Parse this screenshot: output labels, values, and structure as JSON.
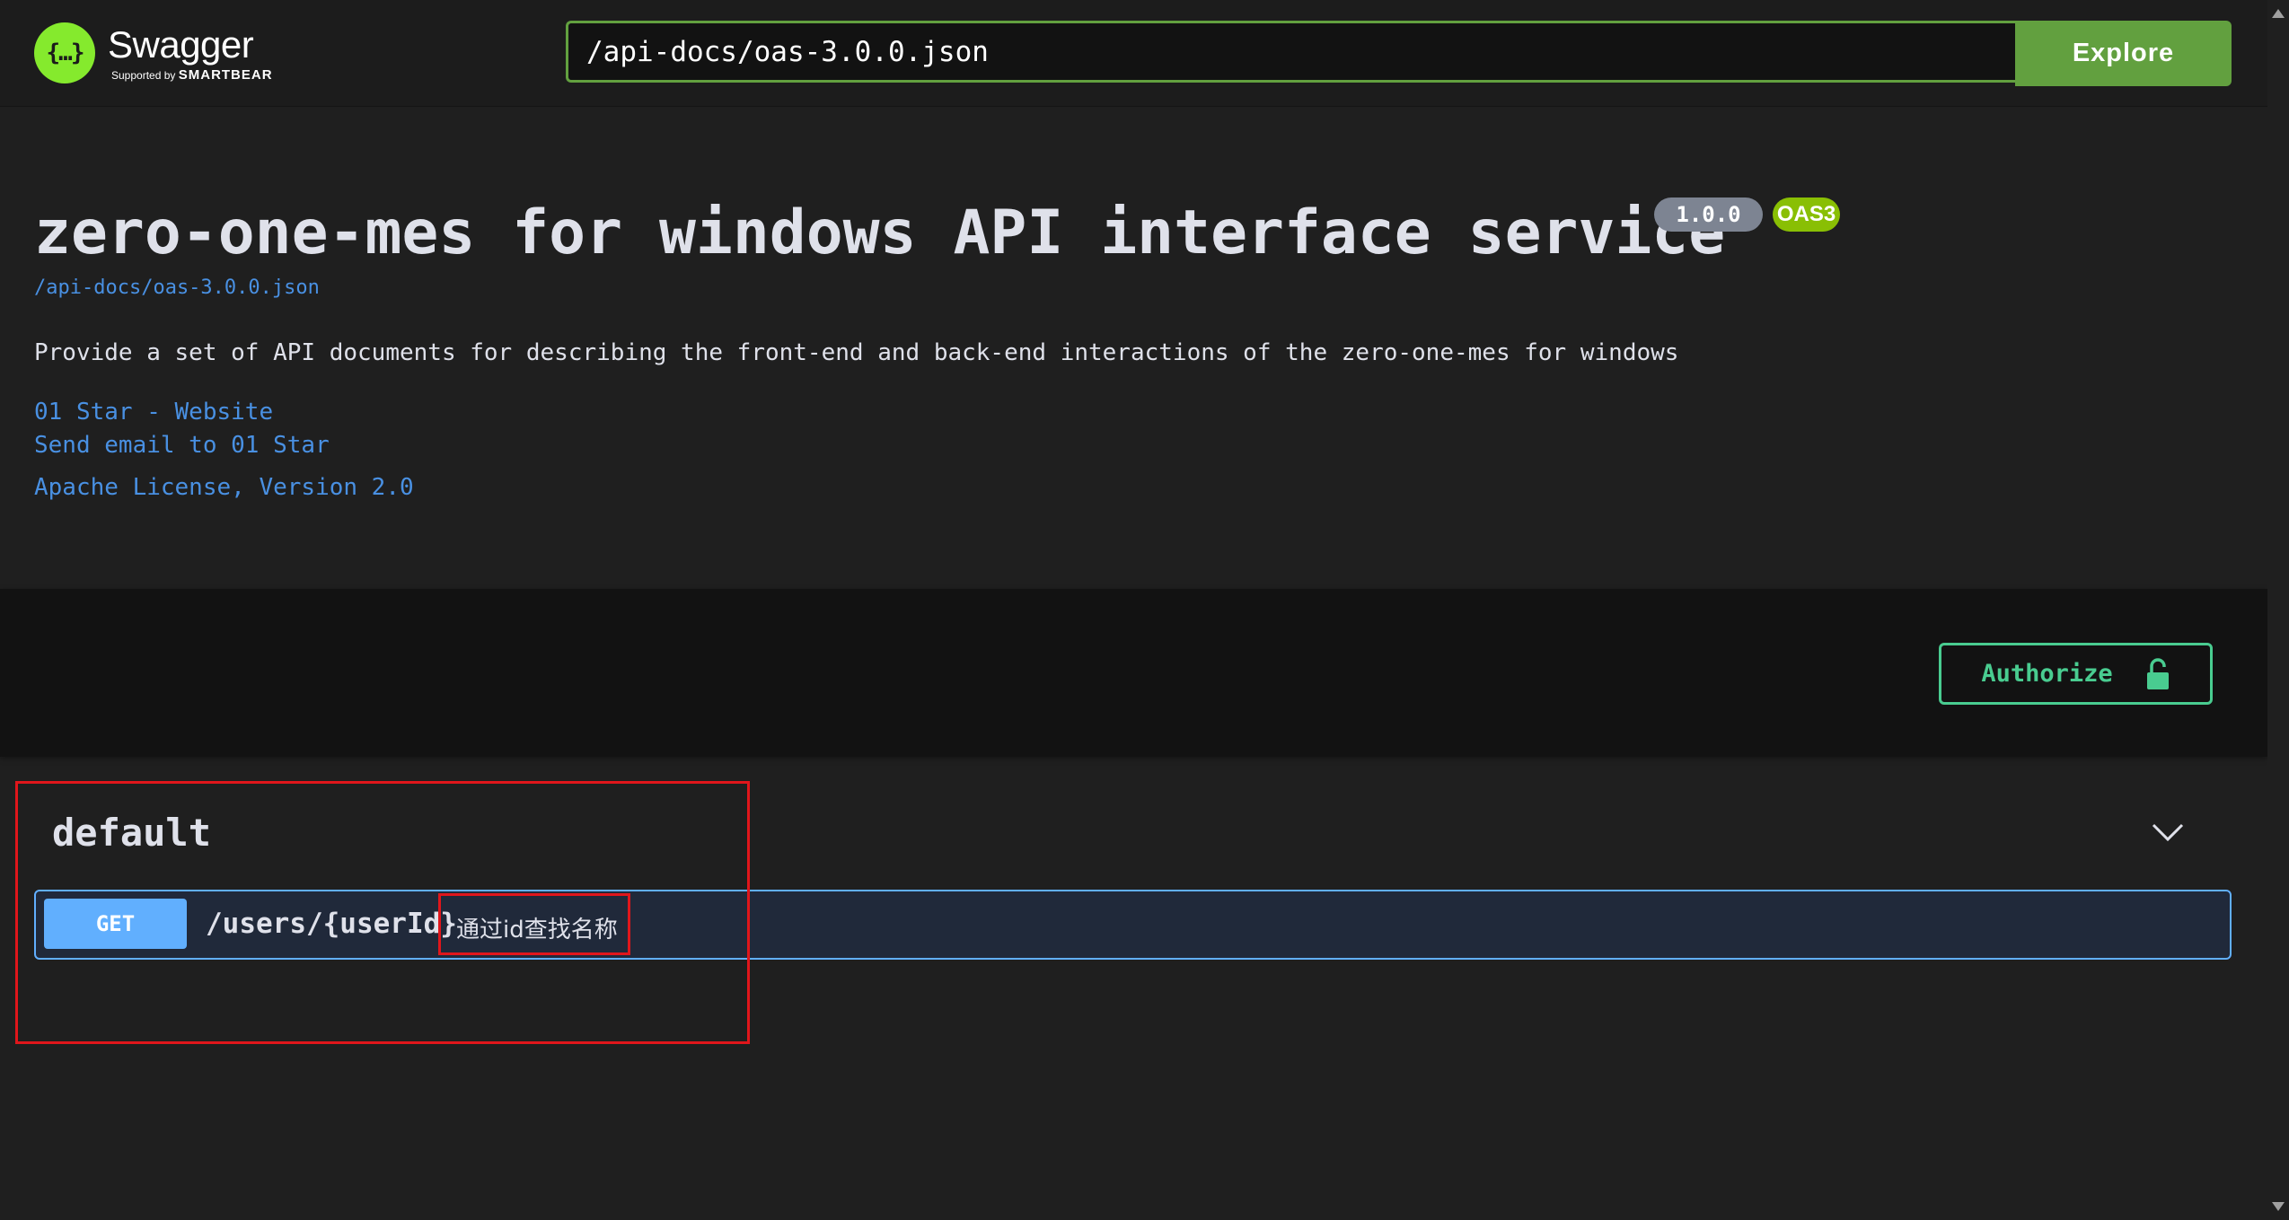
{
  "topbar": {
    "logo_name": "Swagger",
    "logo_mark": "{…}",
    "logo_supported_by": "Supported by",
    "logo_company": "SMARTBEAR",
    "url_value": "/api-docs/oas-3.0.0.json",
    "explore_label": "Explore"
  },
  "info": {
    "title": "zero-one-mes for windows API interface service",
    "version": "1.0.0",
    "oas_badge": "OAS3",
    "spec_link": "/api-docs/oas-3.0.0.json",
    "description": "Provide a set of API documents for describing the front-end and back-end interactions of the zero-one-mes for windows",
    "contact_website": "01 Star - Website",
    "contact_email": "Send email to 01 Star",
    "license": "Apache License, Version 2.0"
  },
  "auth": {
    "authorize_label": "Authorize",
    "lock_icon": "unlock-icon"
  },
  "operations": {
    "tag": "default",
    "items": [
      {
        "method": "GET",
        "path": "/users/{userId}",
        "summary": "通过id查找名称"
      }
    ]
  },
  "colors": {
    "accent_green": "#62a03f",
    "get_blue": "#61affe",
    "authorize_green": "#49cc90",
    "annotation_red": "#e0161b"
  }
}
